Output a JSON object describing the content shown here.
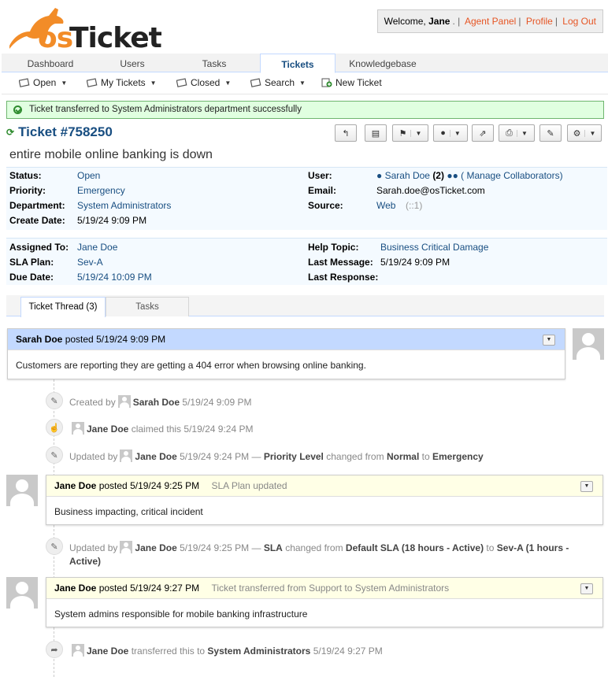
{
  "brand": {
    "logo_os": "os",
    "logo_ticket": "Ticket"
  },
  "welcome": {
    "prefix": "Welcome,",
    "user": "Jane",
    "agent_panel": "Agent Panel",
    "profile": "Profile",
    "logout": "Log Out"
  },
  "nav": {
    "tabs": [
      "Dashboard",
      "Users",
      "Tasks",
      "Tickets",
      "Knowledgebase"
    ],
    "active": "Tickets"
  },
  "subnav": {
    "open": "Open",
    "my_tickets": "My Tickets",
    "closed": "Closed",
    "search": "Search",
    "new_ticket": "New Ticket"
  },
  "notice": "Ticket transferred to System Administrators department successfully",
  "ticket": {
    "number": "Ticket #758250",
    "subject": "entire mobile online banking is down",
    "status_label": "Status:",
    "status": "Open",
    "priority_label": "Priority:",
    "priority": "Emergency",
    "department_label": "Department:",
    "department": "System Administrators",
    "create_date_label": "Create Date:",
    "create_date": "5/19/24 9:09 PM",
    "user_label": "User:",
    "user": "Sarah Doe",
    "user_count": "(2)",
    "manage_collab": "( Manage Collaborators)",
    "email_label": "Email:",
    "email": "Sarah.doe@osTicket.com",
    "source_label": "Source:",
    "source": "Web",
    "source_ip": "(::1)",
    "assigned_label": "Assigned To:",
    "assigned": "Jane Doe",
    "sla_label": "SLA Plan:",
    "sla": "Sev-A",
    "due_label": "Due Date:",
    "due": "5/19/24 10:09 PM",
    "help_topic_label": "Help Topic:",
    "help_topic": "Business Critical Damage",
    "last_message_label": "Last Message:",
    "last_message": "5/19/24 9:09 PM",
    "last_response_label": "Last Response:"
  },
  "thread_tabs": {
    "thread": "Ticket Thread (3)",
    "tasks": "Tasks"
  },
  "entries": [
    {
      "author": "Sarah Doe",
      "posted": "posted 5/19/24 9:09 PM",
      "title": "",
      "body": "Customers are reporting they are getting a 404 error when browsing online banking."
    },
    {
      "author": "Jane Doe",
      "posted": "posted 5/19/24 9:25 PM",
      "title": "SLA Plan updated",
      "body": "Business impacting, critical incident"
    },
    {
      "author": "Jane Doe",
      "posted": "posted 5/19/24 9:27 PM",
      "title": "Ticket transferred from Support to System Administrators",
      "body": "System admins responsible for mobile banking infrastructure"
    }
  ],
  "events": {
    "created": {
      "pre": "Created by",
      "who": "Sarah Doe",
      "when": "5/19/24 9:09 PM"
    },
    "claimed": {
      "who": "Jane Doe",
      "text": "claimed this 5/19/24 9:24 PM"
    },
    "upd1": {
      "pre": "Updated by",
      "who": "Jane Doe",
      "when": "5/19/24 9:24 PM —",
      "field": "Priority Level",
      "mid": "changed from",
      "from": "Normal",
      "to_word": "to",
      "to": "Emergency"
    },
    "upd2": {
      "pre": "Updated by",
      "who": "Jane Doe",
      "when": "5/19/24 9:25 PM —",
      "field": "SLA",
      "mid": "changed from",
      "from": "Default SLA (18 hours - Active)",
      "to_word": "to",
      "to_a": "Sev-A (1 hours -",
      "to_b": "Active)"
    },
    "transfer": {
      "who": "Jane Doe",
      "text": "transferred this to",
      "dept": "System Administrators",
      "when": "5/19/24 9:27 PM"
    }
  }
}
